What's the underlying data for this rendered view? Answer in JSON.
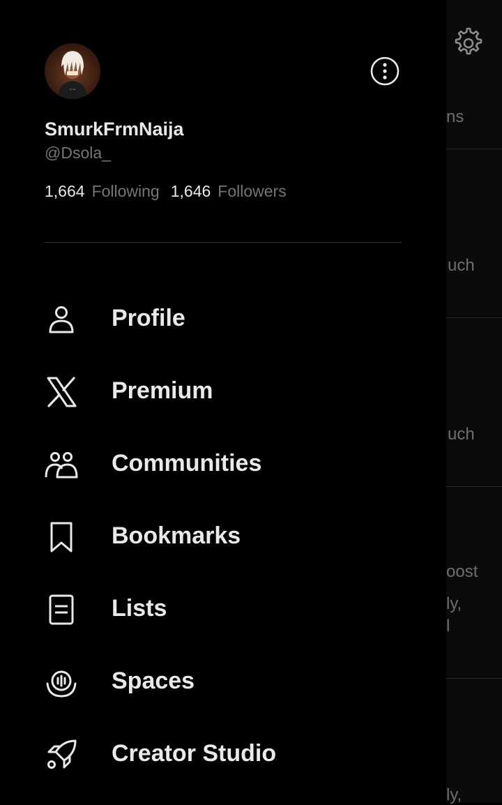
{
  "background": {
    "fragments": [
      "ns",
      "uch",
      "uch",
      "oost",
      "ly,",
      "l",
      "ly,"
    ]
  },
  "profile": {
    "display_name": "SmurkFrmNaija",
    "handle": "@Dsola_",
    "following_count": "1,664",
    "following_label": "Following",
    "followers_count": "1,646",
    "followers_label": "Followers"
  },
  "menu": {
    "items": [
      {
        "label": "Profile",
        "icon": "person-icon"
      },
      {
        "label": "Premium",
        "icon": "x-logo-icon"
      },
      {
        "label": "Communities",
        "icon": "communities-icon"
      },
      {
        "label": "Bookmarks",
        "icon": "bookmark-icon"
      },
      {
        "label": "Lists",
        "icon": "list-icon"
      },
      {
        "label": "Spaces",
        "icon": "spaces-icon"
      },
      {
        "label": "Creator Studio",
        "icon": "rocket-icon"
      }
    ]
  },
  "colors": {
    "background": "#000000",
    "primary_text": "#e7e9ea",
    "secondary_text": "#71767b",
    "divider": "#2f3336"
  }
}
